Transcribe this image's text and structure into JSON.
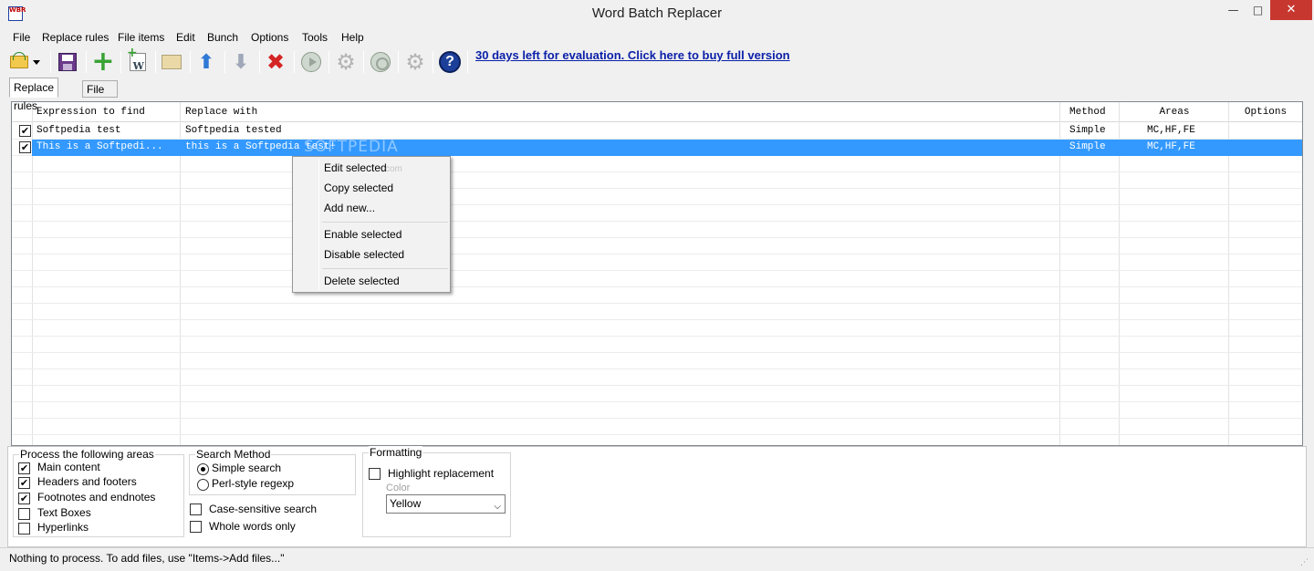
{
  "window": {
    "title": "Word Batch Replacer",
    "app_icon_text": "WBR",
    "minimize_glyph": "—",
    "maximize_glyph": "□",
    "close_glyph": "✕"
  },
  "menu": [
    "File",
    "Replace rules",
    "File items",
    "Edit",
    "Bunch",
    "Options",
    "Tools",
    "Help"
  ],
  "toolbar": {
    "icons": [
      "open-folder-icon",
      "dropdown-arrow-icon",
      "save-icon",
      "add-rule-icon",
      "add-word-file-icon",
      "add-folder-icon",
      "move-up-icon",
      "move-down-icon",
      "delete-icon",
      "run-icon",
      "settings-icon",
      "preview-icon",
      "options-icon",
      "help-icon"
    ],
    "promo_link": "30 days left for evaluation. Click here to buy full version"
  },
  "tabs": [
    "Replace rules",
    "File items"
  ],
  "grid": {
    "columns": [
      "Expression to find",
      "Replace with",
      "Method",
      "Areas",
      "Options"
    ],
    "rows": [
      {
        "checked": true,
        "find": "Softpedia test",
        "replace": "Softpedia tested",
        "method": "Simple",
        "areas": "MC,HF,FE",
        "options": "",
        "selected": false
      },
      {
        "checked": true,
        "find": "This is a Softpedi...",
        "replace": "this is a Softpedia test!",
        "method": "Simple",
        "areas": "MC,HF,FE",
        "options": "",
        "selected": true
      }
    ],
    "watermark": "SOFTPEDIA",
    "watermark_sub": "com"
  },
  "context_menu": {
    "items": [
      "Edit selected",
      "Copy selected",
      "Add new...",
      "Enable selected",
      "Disable selected",
      "Delete selected"
    ]
  },
  "areas_group": {
    "legend": "Process the following areas",
    "options": [
      {
        "label": "Main content",
        "checked": true
      },
      {
        "label": "Headers and footers",
        "checked": true
      },
      {
        "label": "Footnotes and endnotes",
        "checked": true
      },
      {
        "label": "Text Boxes",
        "checked": false
      },
      {
        "label": "Hyperlinks",
        "checked": false
      }
    ]
  },
  "method_group": {
    "legend": "Search Method",
    "options": [
      {
        "label": "Simple search",
        "selected": true
      },
      {
        "label": "Perl-style regexp",
        "selected": false
      }
    ],
    "case_sensitive": {
      "label": "Case-sensitive search",
      "checked": false
    },
    "whole_words": {
      "label": "Whole words only",
      "checked": false
    }
  },
  "formatting_group": {
    "legend": "Formatting",
    "highlight": {
      "label": "Highlight replacement",
      "checked": false
    },
    "color_label": "Color",
    "color_value": "Yellow",
    "dropdown_glyph": "⌵"
  },
  "checkmark_glyph": "✔",
  "status": {
    "text": "Nothing to process. To add files, use \"Items->Add files...\"",
    "grip_glyph": "⋰"
  },
  "colors": {
    "selection": "#3399ff",
    "link": "#0a1fa8",
    "close_button": "#c7372f"
  }
}
